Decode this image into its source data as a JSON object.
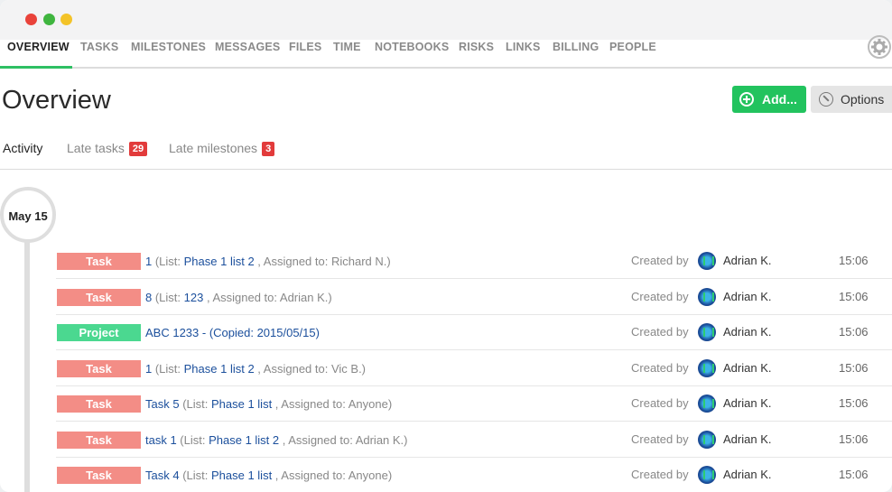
{
  "nav": {
    "items": [
      "OVERVIEW",
      "TASKS",
      "MILESTONES",
      "MESSAGES",
      "FILES",
      "TIME",
      "NOTEBOOKS",
      "RISKS",
      "LINKS",
      "BILLING",
      "PEOPLE"
    ],
    "active": "OVERVIEW"
  },
  "page": {
    "title": "Overview"
  },
  "buttons": {
    "add": "Add...",
    "options": "Options"
  },
  "subtabs": {
    "activity": "Activity",
    "late_tasks": "Late tasks",
    "late_tasks_count": "29",
    "late_milestones": "Late milestones",
    "late_milestones_count": "3"
  },
  "timeline": {
    "date": "May 15",
    "rows": [
      {
        "type": "Task",
        "title": "1",
        "list_prefix": " (List: ",
        "list": "Phase 1 list 2",
        "suffix": " , Assigned to: Richard N.)",
        "created_label": "Created by",
        "person": "Adrian K.",
        "time": "15:06"
      },
      {
        "type": "Task",
        "title": "8",
        "list_prefix": " (List: ",
        "list": "123",
        "suffix": " , Assigned to: Adrian K.)",
        "created_label": "Created by",
        "person": "Adrian K.",
        "time": "15:06"
      },
      {
        "type": "Project",
        "title": "ABC 1233 - (Copied: 2015/05/15)",
        "list_prefix": "",
        "list": "",
        "suffix": "",
        "created_label": "Created by",
        "person": "Adrian K.",
        "time": "15:06"
      },
      {
        "type": "Task",
        "title": "1",
        "list_prefix": " (List: ",
        "list": "Phase 1 list 2",
        "suffix": " , Assigned to: Vic B.)",
        "created_label": "Created by",
        "person": "Adrian K.",
        "time": "15:06"
      },
      {
        "type": "Task",
        "title": "Task 5",
        "list_prefix": " (List: ",
        "list": "Phase 1 list",
        "suffix": " , Assigned to: Anyone)",
        "created_label": "Created by",
        "person": "Adrian K.",
        "time": "15:06"
      },
      {
        "type": "Task",
        "title": "task 1",
        "list_prefix": " (List: ",
        "list": "Phase 1 list 2",
        "suffix": " , Assigned to: Adrian K.)",
        "created_label": "Created by",
        "person": "Adrian K.",
        "time": "15:06"
      },
      {
        "type": "Task",
        "title": "Task 4",
        "list_prefix": " (List: ",
        "list": "Phase 1 list",
        "suffix": " , Assigned to: Anyone)",
        "created_label": "Created by",
        "person": "Adrian K.",
        "time": "15:06"
      }
    ]
  },
  "colors": {
    "accent": "#2ebf63",
    "task_tag": "#f38d86",
    "project_tag": "#4bd890",
    "link": "#1b4f9c",
    "badge": "#e23b3b"
  },
  "icons": [
    "window-close-icon",
    "window-maximize-icon",
    "window-minimize-icon",
    "gear-icon",
    "plus-circle-icon",
    "wrench-icon",
    "avatar-icon"
  ]
}
